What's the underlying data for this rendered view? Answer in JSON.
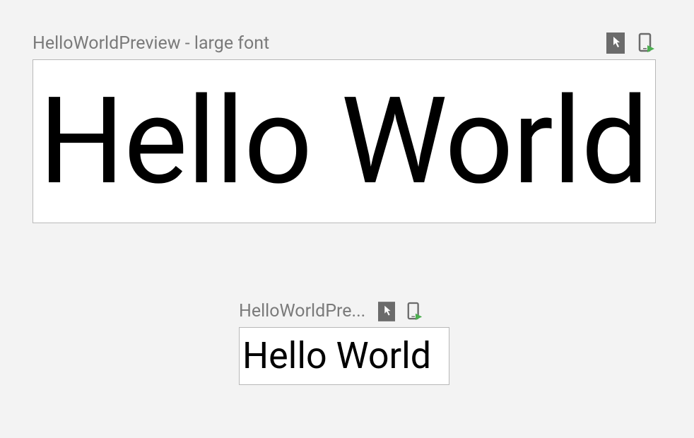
{
  "previews": {
    "large": {
      "title": "HelloWorldPreview - large font",
      "content": "Hello World",
      "icons": {
        "interactive": "interactive-mode-icon",
        "deploy": "deploy-device-icon"
      }
    },
    "small": {
      "title": "HelloWorldPre...",
      "content": "Hello World",
      "icons": {
        "interactive": "interactive-mode-icon",
        "deploy": "deploy-device-icon"
      }
    }
  },
  "colors": {
    "background": "#f3f3f3",
    "canvas": "#ffffff",
    "border": "#b8b8b8",
    "titleText": "#7a7a7a",
    "iconBg": "#6b6b6b",
    "accent": "#4caf50"
  }
}
